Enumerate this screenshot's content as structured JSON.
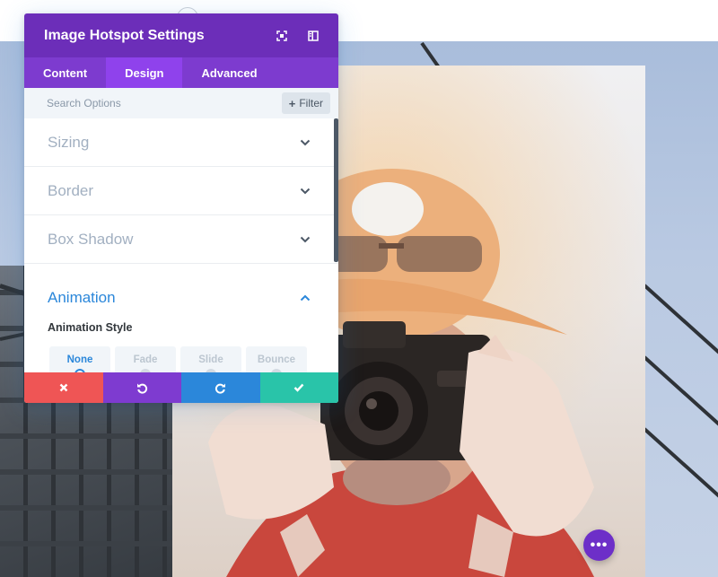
{
  "modal": {
    "title": "Image Hotspot Settings",
    "tabs": [
      {
        "label": "Content"
      },
      {
        "label": "Design"
      },
      {
        "label": "Advanced"
      }
    ],
    "active_tab": "Design",
    "search": {
      "placeholder": "Search Options",
      "value": ""
    },
    "filter_label": "Filter",
    "toggles": [
      {
        "label": "Sizing",
        "state": "collapsed"
      },
      {
        "label": "Border",
        "state": "collapsed"
      },
      {
        "label": "Box Shadow",
        "state": "collapsed"
      },
      {
        "label": "Animation",
        "state": "expanded"
      }
    ],
    "animation": {
      "field_label": "Animation Style",
      "options": [
        "None",
        "Fade",
        "Slide",
        "Bounce"
      ],
      "selected": "None"
    },
    "actions": [
      "discard",
      "undo",
      "redo",
      "save"
    ]
  },
  "icons": {
    "header": [
      "fullscreen-icon",
      "sidebar-toggle-icon"
    ],
    "fab": "more-dots-icon"
  },
  "colors": {
    "header": "#6c2eb9",
    "tabs": "#7d3bcf",
    "active_tab": "#8f42ec",
    "accent_blue": "#2b87da",
    "discard": "#ef5555",
    "undo": "#7e3bd0",
    "redo": "#2b87da",
    "save": "#29c4a9"
  }
}
